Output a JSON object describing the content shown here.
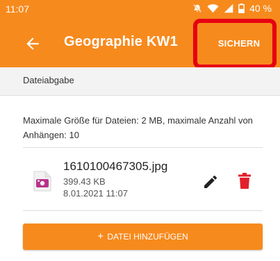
{
  "colors": {
    "accent": "#f78a1d",
    "highlight": "#e60012",
    "delete": "#e2202c"
  },
  "status_bar": {
    "time": "11:07",
    "battery": "40 %",
    "icons": [
      "bell-off-icon",
      "wifi-icon",
      "signal-icon",
      "battery-icon"
    ]
  },
  "app_bar": {
    "back_icon": "arrow-left-icon",
    "title": "Geographie KW1",
    "save_label": "SICHERN"
  },
  "section": {
    "header": "Dateiabgabe"
  },
  "info": {
    "text": "Maximale Größe für Dateien: 2 MB, maximale Anzahl von Anhängen: 10"
  },
  "files": [
    {
      "name": "1610100467305.jpg",
      "size": "399.43 KB",
      "date": "8.01.2021 11:07",
      "icon": "image-file-icon"
    }
  ],
  "actions": {
    "edit_icon": "pencil-icon",
    "delete_icon": "trash-icon",
    "add_plus": "+",
    "add_label": "DATEI HINZUFÜGEN"
  }
}
